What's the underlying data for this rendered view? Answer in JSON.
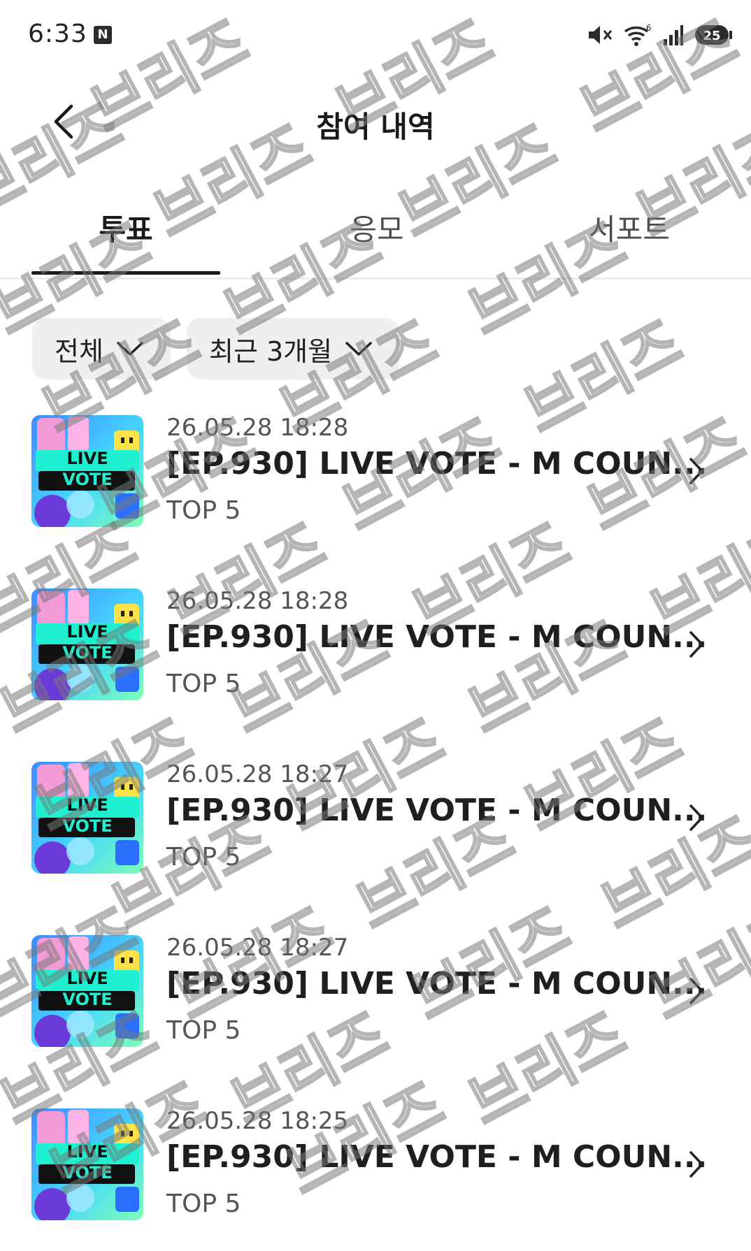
{
  "status_bar": {
    "time": "6:33",
    "notification_badge": "N",
    "icons": [
      "mute-icon",
      "wifi-icon",
      "signal-icon",
      "battery-icon"
    ],
    "battery_level": "25"
  },
  "header": {
    "title": "참여 내역"
  },
  "tabs": [
    {
      "label": "투표",
      "active": true
    },
    {
      "label": "응모",
      "active": false
    },
    {
      "label": "서포트",
      "active": false
    }
  ],
  "filters": {
    "category": "전체",
    "period": "최근 3개월"
  },
  "items": [
    {
      "date": "26.05.28 18:28",
      "title": "[EP.930] LIVE VOTE - M COUN...",
      "subtitle": "TOP 5",
      "thumb_line1": "LIVE",
      "thumb_line2": "VOTE"
    },
    {
      "date": "26.05.28 18:28",
      "title": "[EP.930] LIVE VOTE - M COUN...",
      "subtitle": "TOP 5",
      "thumb_line1": "LIVE",
      "thumb_line2": "VOTE"
    },
    {
      "date": "26.05.28 18:27",
      "title": "[EP.930] LIVE VOTE - M COUN...",
      "subtitle": "TOP 5",
      "thumb_line1": "LIVE",
      "thumb_line2": "VOTE"
    },
    {
      "date": "26.05.28 18:27",
      "title": "[EP.930] LIVE VOTE - M COUN...",
      "subtitle": "TOP 5",
      "thumb_line1": "LIVE",
      "thumb_line2": "VOTE"
    },
    {
      "date": "26.05.28 18:25",
      "title": "[EP.930] LIVE VOTE - M COUN...",
      "subtitle": "TOP 5",
      "thumb_line1": "LIVE",
      "thumb_line2": "VOTE"
    }
  ],
  "watermark": "브리즈",
  "colors": {
    "accent": "#1a1a1a",
    "filter_bg": "#efefef",
    "divider": "#ececec"
  }
}
